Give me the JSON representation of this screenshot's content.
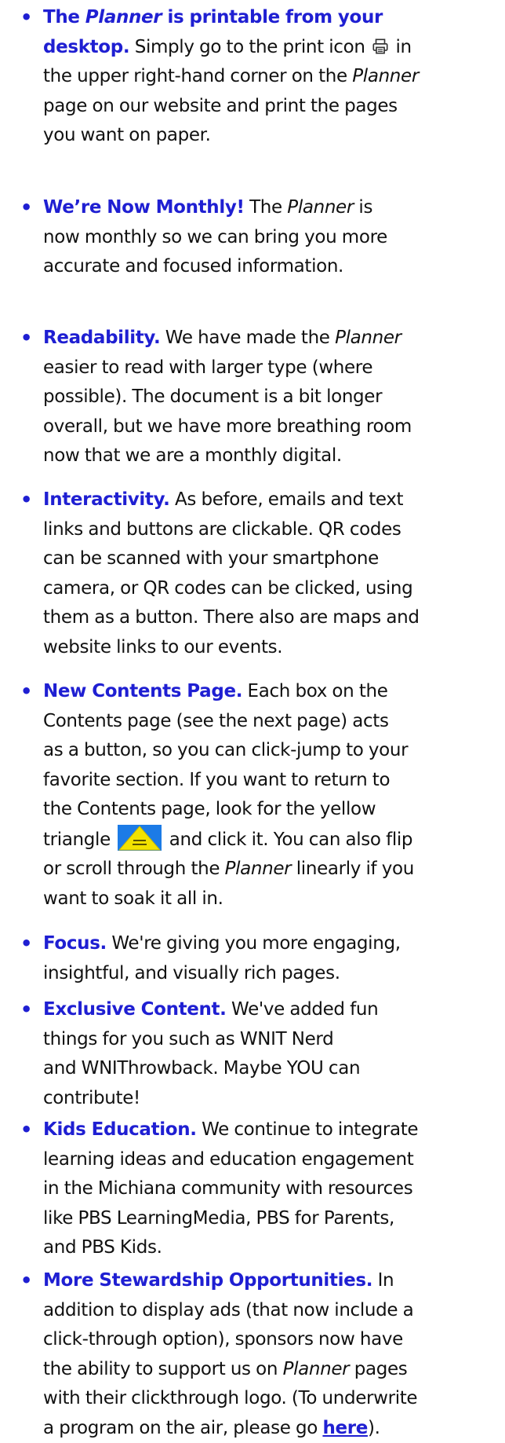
{
  "icons": {
    "print": "printer-icon",
    "back_to_contents": "back-to-contents-triangle-icon"
  },
  "colors": {
    "heading": "#1f1fd2",
    "body": "#111111",
    "triangle_fill": "#f2e200",
    "triangle_bg": "#1c7be6"
  },
  "items": [
    {
      "bullet": "•",
      "lines": [
        [
          "The ",
          "Planner",
          " is printable from your"
        ],
        [
          "desktop.",
          " Simply go to the print icon ",
          " in"
        ],
        [
          "the upper right-hand corner on the ",
          "Planner"
        ],
        [
          "page on our website and print the pages"
        ],
        [
          "you want on paper."
        ]
      ]
    },
    {
      "bullet": "•",
      "heading": "We’re Now Monthly!",
      "lines": [
        [
          " The ",
          "Planner",
          " is"
        ],
        [
          "now monthly so we can bring you more"
        ],
        [
          "accurate and focused information."
        ]
      ]
    },
    {
      "bullet": "•",
      "heading": "Readability.",
      "lines": [
        [
          " We have made the ",
          "Planner"
        ],
        [
          "easier to read with larger type (where"
        ],
        [
          "possible). The document is a bit longer"
        ],
        [
          "overall, but we have more breathing room"
        ],
        [
          "now that we are a monthly digital."
        ]
      ]
    },
    {
      "bullet": "•",
      "heading": "Interactivity.",
      "lines": [
        [
          " As before, emails and text"
        ],
        [
          "links and buttons are clickable. QR codes"
        ],
        [
          "can be scanned with your smartphone"
        ],
        [
          "camera, or QR codes can be clicked, using"
        ],
        [
          "them as a button. There also are maps and"
        ],
        [
          "website links to our events."
        ]
      ]
    },
    {
      "bullet": "•",
      "heading": "New Contents Page.",
      "lines": [
        [
          " Each box on the"
        ],
        [
          "Contents page (see the next page) acts"
        ],
        [
          "as a button, so you can click-jump to your"
        ],
        [
          "favorite section. If you want to return to"
        ],
        [
          "the Contents page, look for the yellow"
        ],
        [
          "triangle ",
          " and click it. You can also flip"
        ],
        [
          "or scroll through the ",
          "Planner",
          " linearly if you"
        ],
        [
          "want to soak it all in."
        ]
      ]
    },
    {
      "bullet": "•",
      "heading": "Focus.",
      "lines": [
        [
          " We're giving you more engaging,"
        ],
        [
          "insightful, and visually rich pages."
        ]
      ]
    },
    {
      "bullet": "•",
      "heading": "Exclusive Content.",
      "lines": [
        [
          " We've added fun"
        ],
        [
          "things for you such as WNIT Nerd"
        ],
        [
          "and WNIThrowback. Maybe YOU can"
        ],
        [
          "contribute!"
        ]
      ]
    },
    {
      "bullet": "•",
      "heading": "Kids Education.",
      "lines": [
        [
          " We continue to integrate"
        ],
        [
          "learning ideas and education engagement"
        ],
        [
          "in the Michiana community with resources"
        ],
        [
          "like PBS LearningMedia, PBS for Parents,"
        ],
        [
          "and PBS Kids."
        ]
      ]
    },
    {
      "bullet": "•",
      "heading": "More Stewardship Opportunities.",
      "lines": [
        [
          " In"
        ],
        [
          "addition to display ads (that now include a"
        ],
        [
          "click-through option), sponsors now have"
        ],
        [
          "the ability to support us on ",
          "Planner",
          " pages"
        ],
        [
          "with their clickthrough logo. (To underwrite"
        ],
        [
          "a program on the air, please go ",
          "here",
          ")."
        ]
      ]
    }
  ]
}
